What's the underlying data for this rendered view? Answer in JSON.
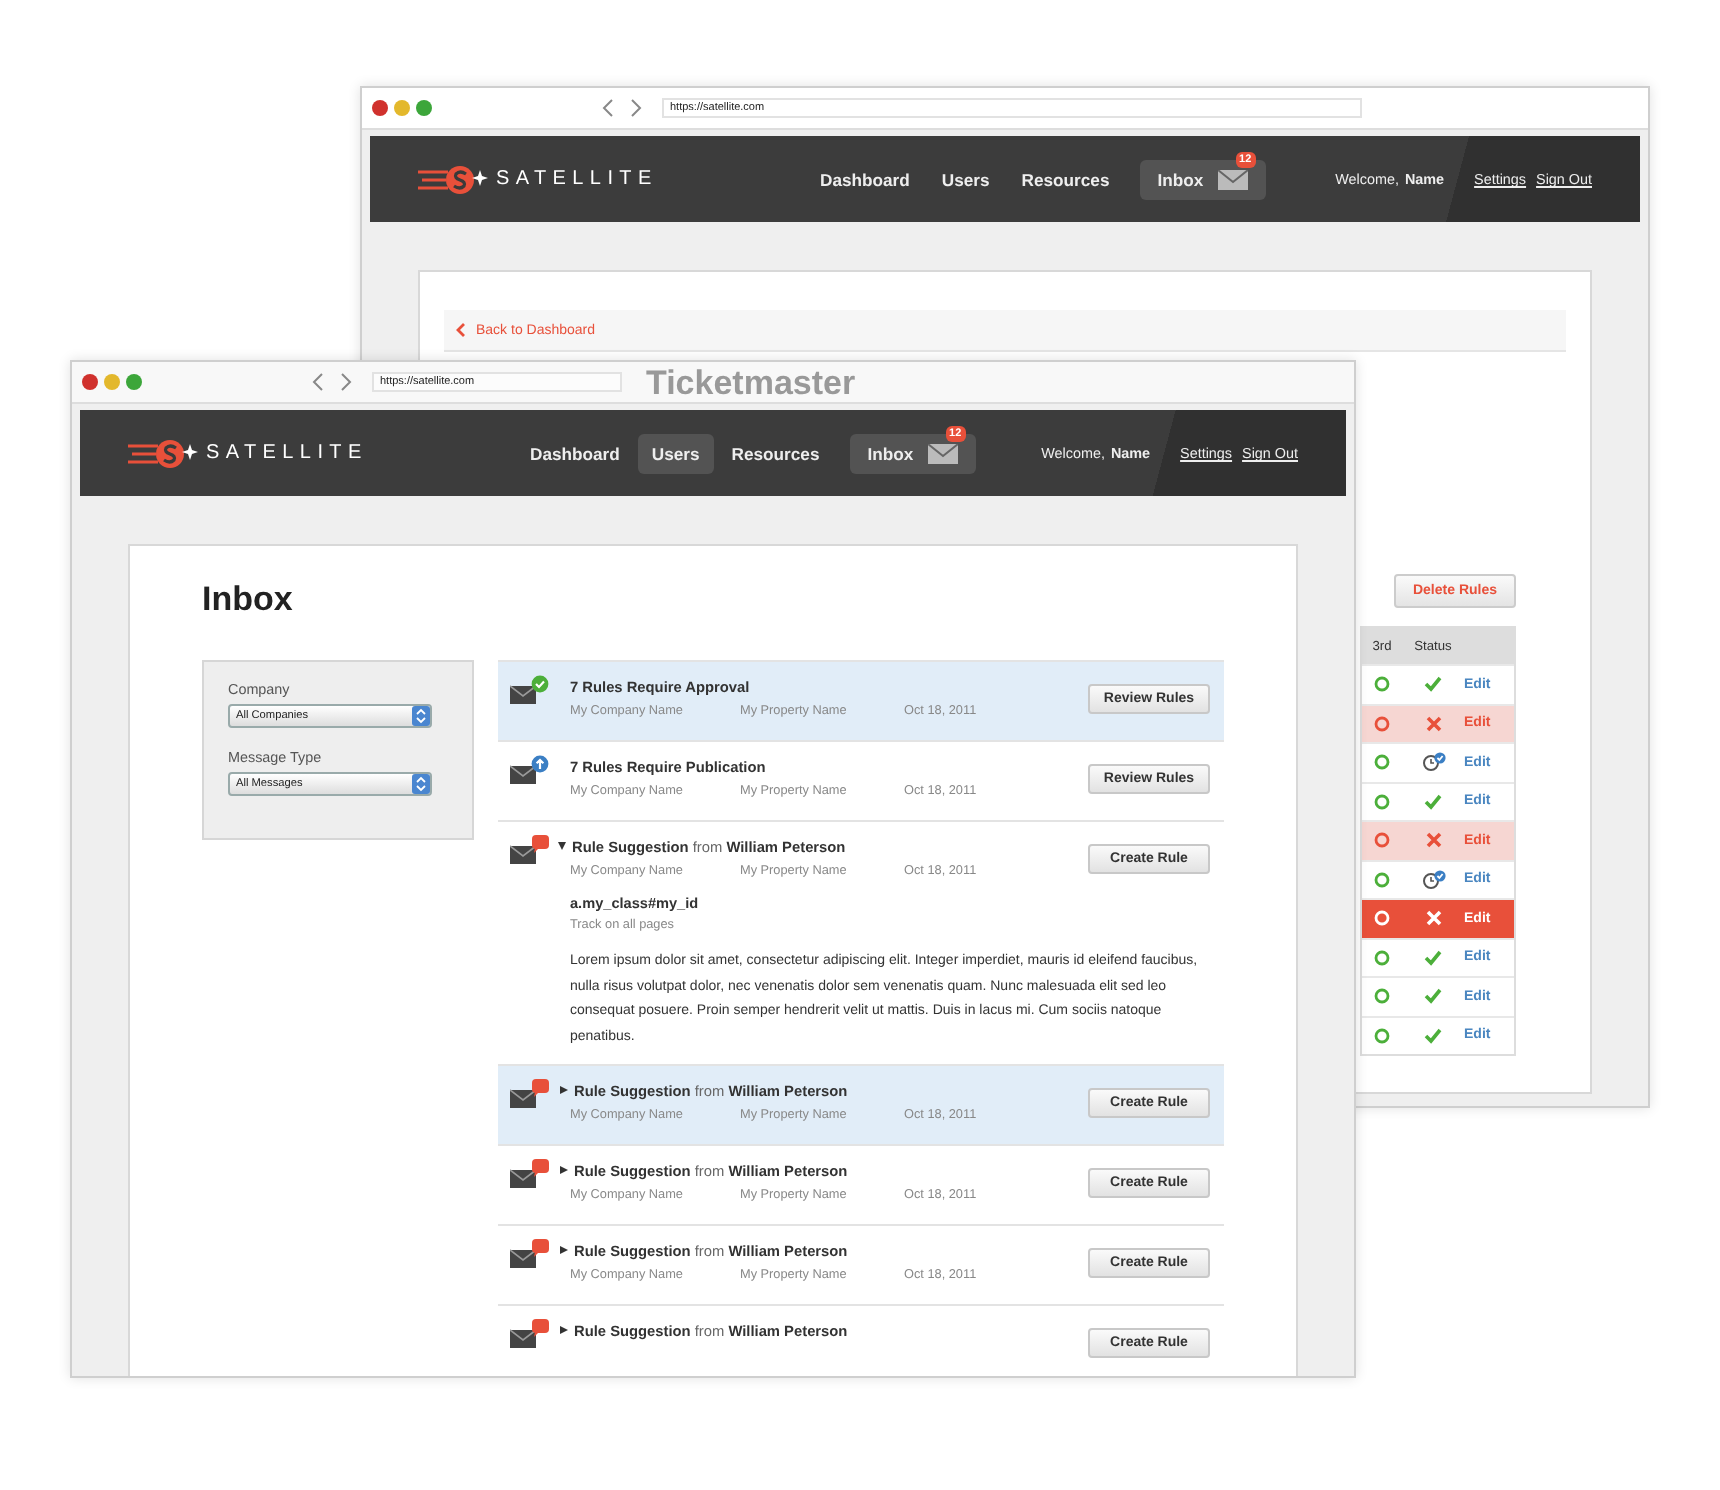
{
  "windows": [
    {
      "kind": "rules",
      "url": "https://satellite.com",
      "brand": "SATELLITE",
      "nav": [
        {
          "label": "Dashboard",
          "selected": false
        },
        {
          "label": "Users",
          "selected": false
        },
        {
          "label": "Resources",
          "selected": false
        }
      ],
      "inbox": {
        "label": "Inbox",
        "count": "12"
      },
      "welcome": "Welcome,",
      "user": "Name",
      "links": [
        "Settings",
        "Sign Out"
      ],
      "back_link": "Back to Dashboard",
      "heading": "Ticketmaster",
      "delete_button": "Delete Rules",
      "table": {
        "columns": [
          "3rd",
          "Status"
        ],
        "rows": [
          {
            "kind": "ok",
            "selected": false,
            "action": "Edit"
          },
          {
            "kind": "error",
            "selected": false,
            "action": "Edit"
          },
          {
            "kind": "pending",
            "selected": false,
            "action": "Edit"
          },
          {
            "kind": "ok",
            "selected": false,
            "action": "Edit"
          },
          {
            "kind": "error",
            "selected": false,
            "action": "Edit"
          },
          {
            "kind": "pending",
            "selected": false,
            "action": "Edit"
          },
          {
            "kind": "error",
            "selected": true,
            "action": "Edit"
          },
          {
            "kind": "ok",
            "selected": false,
            "action": "Edit"
          },
          {
            "kind": "ok",
            "selected": false,
            "action": "Edit"
          },
          {
            "kind": "ok",
            "selected": false,
            "action": "Edit"
          }
        ]
      }
    },
    {
      "kind": "inbox",
      "url": "https://satellite.com",
      "brand": "SATELLITE",
      "nav": [
        {
          "label": "Dashboard",
          "selected": false
        },
        {
          "label": "Users",
          "selected": true
        },
        {
          "label": "Resources",
          "selected": false
        }
      ],
      "inbox": {
        "label": "Inbox",
        "count": "12"
      },
      "welcome": "Welcome,",
      "user": "Name",
      "links": [
        "Settings",
        "Sign Out"
      ],
      "title": "Inbox",
      "filters": [
        {
          "label": "Company",
          "value": "All Companies"
        },
        {
          "label": "Message Type",
          "value": "All Messages"
        }
      ],
      "messages": [
        {
          "kind": "approval",
          "selected": true,
          "title": "7 Rules Require Approval",
          "company": "My Company Name",
          "property": "My Property Name",
          "date": "Oct 18, 2011",
          "button": "Review Rules"
        },
        {
          "kind": "publication",
          "selected": false,
          "title": "7 Rules Require Publication",
          "company": "My Company Name",
          "property": "My Property Name",
          "date": "Oct 18, 2011",
          "button": "Review Rules"
        },
        {
          "kind": "suggestion",
          "selected": false,
          "expanded": true,
          "title": "**Rule Suggestion** from **William Peterson**",
          "company": "My Company Name",
          "property": "My Property Name",
          "date": "Oct 18, 2011",
          "button": "Create Rule",
          "detail": {
            "selector": "a.my_class#my_id",
            "note": "Track on all pages",
            "body": "Lorem ipsum dolor sit amet, consectetur adipiscing elit. Integer imperdiet, mauris id eleifend faucibus, nulla risus volutpat dolor, nec venenatis dolor sem venenatis quam. Nunc malesuada elit sed leo consequat posuere. Proin semper hendrerit velit ut mattis. Duis in lacus mi. Cum sociis natoque penatibus."
          }
        },
        {
          "kind": "suggestion",
          "selected": true,
          "expanded": false,
          "title": "**Rule Suggestion** from **William Peterson**",
          "company": "My Company Name",
          "property": "My Property Name",
          "date": "Oct 18, 2011",
          "button": "Create Rule"
        },
        {
          "kind": "suggestion",
          "selected": false,
          "expanded": false,
          "title": "**Rule Suggestion** from **William Peterson**",
          "company": "My Company Name",
          "property": "My Property Name",
          "date": "Oct 18, 2011",
          "button": "Create Rule"
        },
        {
          "kind": "suggestion",
          "selected": false,
          "expanded": false,
          "title": "**Rule Suggestion** from **William Peterson**",
          "company": "My Company Name",
          "property": "My Property Name",
          "date": "Oct 18, 2011",
          "button": "Create Rule"
        },
        {
          "kind": "suggestion",
          "selected": false,
          "expanded": false,
          "title": "**Rule Suggestion** from **William Peterson**",
          "button": "Create Rule"
        }
      ]
    }
  ]
}
